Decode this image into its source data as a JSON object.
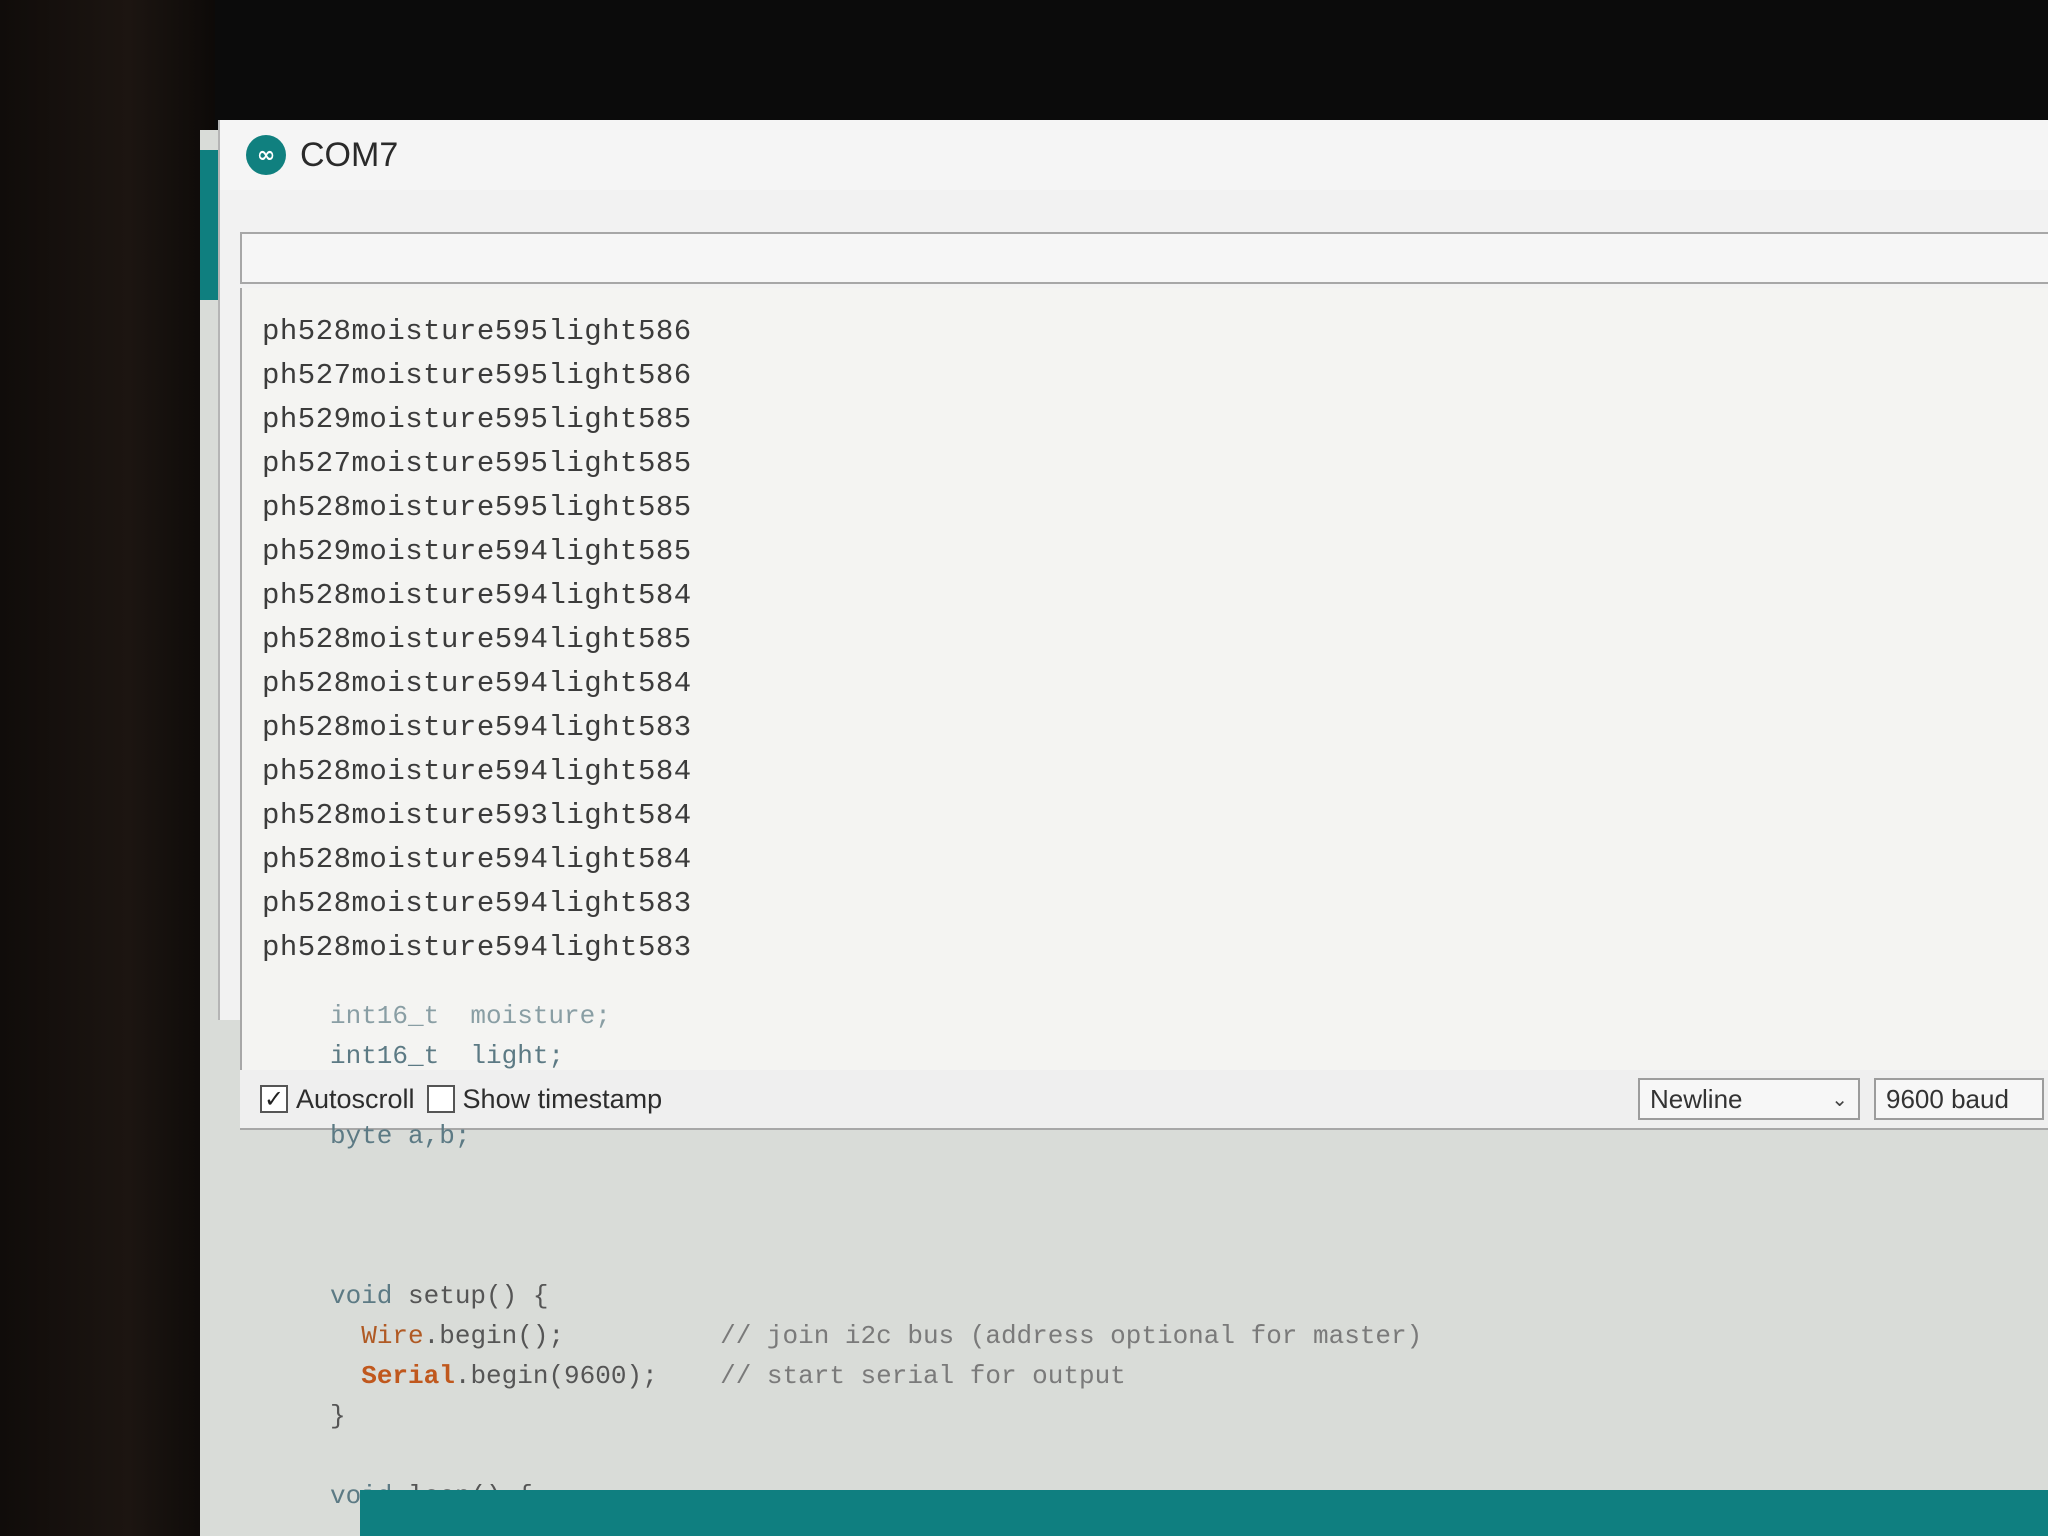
{
  "window": {
    "title": "COM7"
  },
  "send": {
    "value": ""
  },
  "serial_output": [
    "ph528moisture595light586",
    "ph527moisture595light586",
    "ph529moisture595light585",
    "ph527moisture595light585",
    "ph528moisture595light585",
    "ph529moisture594light585",
    "ph528moisture594light584",
    "ph528moisture594light585",
    "ph528moisture594light584",
    "ph528moisture594light583",
    "ph528moisture594light584",
    "ph528moisture593light584",
    "ph528moisture594light584",
    "ph528moisture594light583",
    "ph528moisture594light583"
  ],
  "statusbar": {
    "autoscroll_label": "Autoscroll",
    "autoscroll_checked": true,
    "timestamp_label": "Show timestamp",
    "timestamp_checked": false,
    "line_ending": "Newline",
    "baud": "9600 baud"
  },
  "code": {
    "cut_line": "int16_t  moisture;",
    "light_decl": "int16_t  light;",
    "byte_decl": "byte a,b;",
    "setup_kw": "void",
    "setup_rest": " setup() {",
    "wire_obj": "Wire",
    "wire_call": ".begin();",
    "wire_comment": "// join i2c bus (address optional for master)",
    "serial_obj": "Serial",
    "serial_call": ".begin(9600);",
    "serial_comment": "// start serial for output",
    "close_brace": "}",
    "loop_kw": "void",
    "loop_rest": " loop() {"
  },
  "colors": {
    "accent": "#10807f",
    "background": "#f2f2f2",
    "text": "#3b3b3b"
  },
  "icons": {
    "app": "arduino-infinity-icon",
    "dropdown": "chevron-down-icon",
    "check": "checkmark-icon"
  }
}
